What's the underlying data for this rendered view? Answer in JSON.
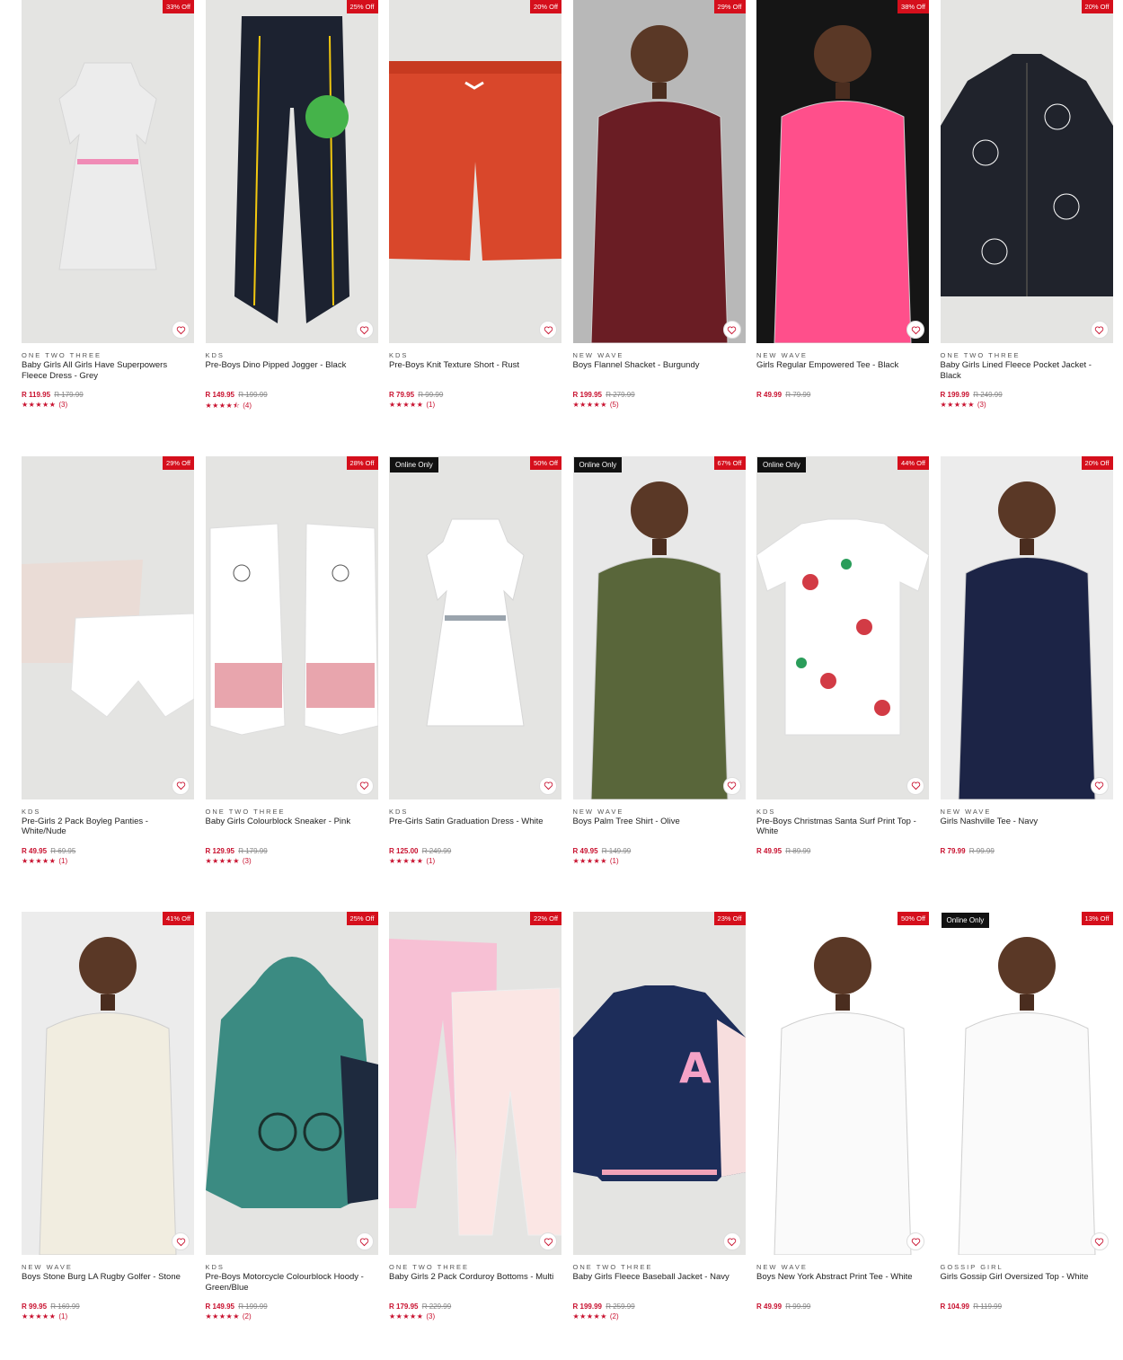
{
  "colors": {
    "discount": "#d50f1c",
    "price": "#c8102e",
    "online_badge": "#111111",
    "image_bg": "#e4e4e2"
  },
  "products": [
    {
      "brand": "ONE TWO THREE",
      "name": "Baby Girls All Girls Have Superpowers Fleece Dress - Grey",
      "price": "R 119.95",
      "was": "R 179.99",
      "discount": "33% Off",
      "online": "",
      "stars": "★★★★★",
      "reviews": "(3)",
      "art": "dress",
      "c1": "#ececec",
      "c2": "#f08bb6"
    },
    {
      "brand": "KDS",
      "name": "Pre-Boys Dino Pipped Jogger - Black",
      "price": "R 149.95",
      "was": "R 199.99",
      "discount": "25% Off",
      "online": "",
      "stars": "★★★★⯪",
      "reviews": "(4)",
      "art": "pants",
      "c1": "#1c2230",
      "c2": "#f2c80f"
    },
    {
      "brand": "KDS",
      "name": "Pre-Boys Knit Texture Short - Rust",
      "price": "R 79.95",
      "was": "R 99.99",
      "discount": "20% Off",
      "online": "",
      "stars": "★★★★★",
      "reviews": "(1)",
      "art": "shorts",
      "c1": "#d9472b",
      "c2": "#ffffff"
    },
    {
      "brand": "NEW WAVE",
      "name": "Boys Flannel Shacket - Burgundy",
      "price": "R 199.95",
      "was": "R 279.99",
      "discount": "29% Off",
      "online": "",
      "stars": "★★★★★",
      "reviews": "(5)",
      "art": "person",
      "c1": "#b8b8b8",
      "c2": "#6a1d24"
    },
    {
      "brand": "NEW WAVE",
      "name": "Girls Regular Empowered Tee - Black",
      "price": "R 49.99",
      "was": "R 79.99",
      "discount": "38% Off",
      "online": "",
      "stars": "",
      "reviews": "",
      "art": "person",
      "c1": "#151515",
      "c2": "#ff4f8b"
    },
    {
      "brand": "ONE TWO THREE",
      "name": "Baby Girls Lined Fleece Pocket Jacket - Black",
      "price": "R 199.99",
      "was": "R 249.99",
      "discount": "20% Off",
      "online": "",
      "stars": "★★★★★",
      "reviews": "(3)",
      "art": "jacket",
      "c1": "#20232c",
      "c2": "#ffffff"
    },
    {
      "brand": "KDS",
      "name": "Pre-Girls 2 Pack Boyleg Panties - White/Nude",
      "price": "R 49.95",
      "was": "R 69.95",
      "discount": "29% Off",
      "online": "",
      "stars": "★★★★★",
      "reviews": "(1)",
      "art": "panties",
      "c1": "#eadcd6",
      "c2": "#ffffff"
    },
    {
      "brand": "ONE TWO THREE",
      "name": "Baby Girls Colourblock Sneaker - Pink",
      "price": "R 129.95",
      "was": "R 179.99",
      "discount": "28% Off",
      "online": "",
      "stars": "★★★★★",
      "reviews": "(3)",
      "art": "shoes",
      "c1": "#ffffff",
      "c2": "#e8a5ad"
    },
    {
      "brand": "KDS",
      "name": "Pre-Girls Satin Graduation Dress - White",
      "price": "R 125.00",
      "was": "R 249.99",
      "discount": "50% Off",
      "online": "Online Only",
      "stars": "★★★★★",
      "reviews": "(1)",
      "art": "dress",
      "c1": "#ffffff",
      "c2": "#9aa4ad"
    },
    {
      "brand": "NEW WAVE",
      "name": "Boys Palm Tree Shirt - Olive",
      "price": "R 49.95",
      "was": "R 149.99",
      "discount": "67% Off",
      "online": "Online Only",
      "stars": "★★★★★",
      "reviews": "(1)",
      "art": "person",
      "c1": "#e8e8e8",
      "c2": "#59663a"
    },
    {
      "brand": "KDS",
      "name": "Pre-Boys Christmas Santa Surf Print Top - White",
      "price": "R 49.95",
      "was": "R 89.99",
      "discount": "44% Off",
      "online": "Online Only",
      "stars": "",
      "reviews": "",
      "art": "tee",
      "c1": "#ffffff",
      "c2": "#d23b45"
    },
    {
      "brand": "NEW WAVE",
      "name": "Girls Nashville Tee - Navy",
      "price": "R 79.99",
      "was": "R 99.99",
      "discount": "20% Off",
      "online": "",
      "stars": "",
      "reviews": "",
      "art": "person",
      "c1": "#ececec",
      "c2": "#1c2446"
    },
    {
      "brand": "NEW WAVE",
      "name": "Boys Stone Burg LA Rugby Golfer - Stone",
      "price": "R 99.95",
      "was": "R 169.99",
      "discount": "41% Off",
      "online": "",
      "stars": "★★★★★",
      "reviews": "(1)",
      "art": "person",
      "c1": "#ececec",
      "c2": "#f1ede0"
    },
    {
      "brand": "KDS",
      "name": "Pre-Boys Motorcycle Colourblock Hoody - Green/Blue",
      "price": "R 149.95",
      "was": "R 199.99",
      "discount": "25% Off",
      "online": "",
      "stars": "★★★★★",
      "reviews": "(2)",
      "art": "hoody",
      "c1": "#3b8b82",
      "c2": "#1e2a3e"
    },
    {
      "brand": "ONE TWO THREE",
      "name": "Baby Girls 2 Pack Corduroy Bottoms - Multi",
      "price": "R 179.95",
      "was": "R 229.99",
      "discount": "22% Off",
      "online": "",
      "stars": "★★★★★",
      "reviews": "(3)",
      "art": "pants2",
      "c1": "#f7c0d4",
      "c2": "#fbe6e4"
    },
    {
      "brand": "ONE TWO THREE",
      "name": "Baby Girls Fleece Baseball Jacket - Navy",
      "price": "R 199.99",
      "was": "R 259.99",
      "discount": "23% Off",
      "online": "",
      "stars": "★★★★★",
      "reviews": "(2)",
      "art": "bomber",
      "c1": "#1d2d5a",
      "c2": "#f7dede"
    },
    {
      "brand": "NEW WAVE",
      "name": "Boys New York Abstract Print Tee - White",
      "price": "R 49.99",
      "was": "R 99.99",
      "discount": "50% Off",
      "online": "",
      "stars": "",
      "reviews": "",
      "art": "person",
      "c1": "#ffffff",
      "c2": "#fafafa"
    },
    {
      "brand": "GOSSIP GIRL",
      "name": "Girls Gossip Girl Oversized Top - White",
      "price": "R 104.99",
      "was": "R 119.99",
      "discount": "13% Off",
      "online": "Online Only",
      "stars": "",
      "reviews": "",
      "art": "person",
      "c1": "#ffffff",
      "c2": "#fafafa"
    }
  ]
}
